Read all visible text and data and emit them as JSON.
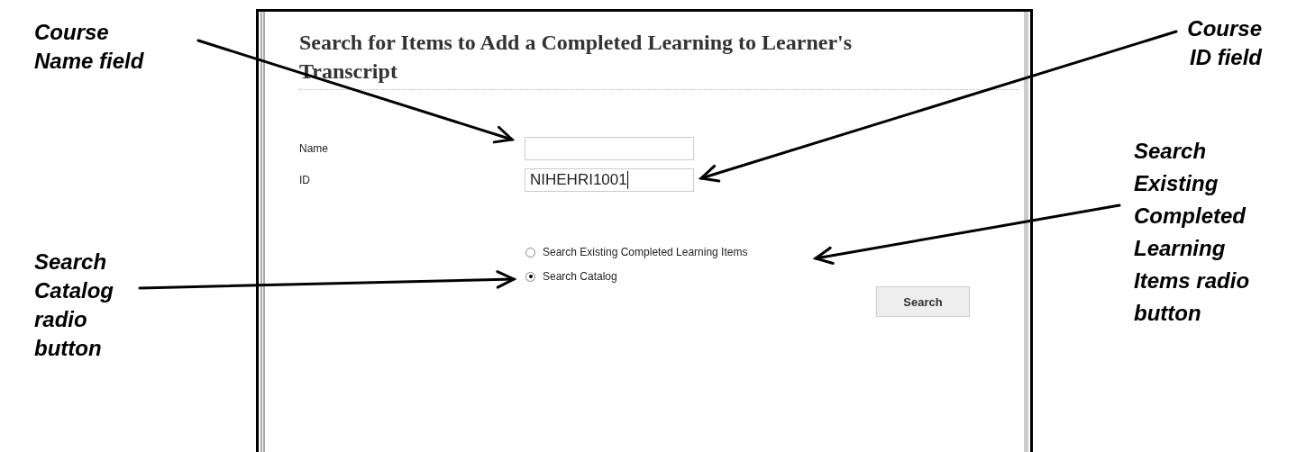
{
  "screen": {
    "title": "Search for Items to Add a Completed Learning to Learner's Transcript",
    "fields": [
      {
        "label": "Name",
        "caret": false
      },
      {
        "label": "ID",
        "value": "NIHEHRI1001",
        "caret": true
      }
    ],
    "options": [
      {
        "label": "Search Existing Completed Learning Items",
        "selected": false
      },
      {
        "label": "Search Catalog",
        "selected": true
      }
    ],
    "button": "Search"
  },
  "callouts": [
    {
      "text": "Course Name field"
    },
    {
      "text": "Course ID field"
    },
    {
      "text": "Search Existing Completed Learning Items radio button"
    },
    {
      "text": "Search Catalog radio button"
    }
  ]
}
